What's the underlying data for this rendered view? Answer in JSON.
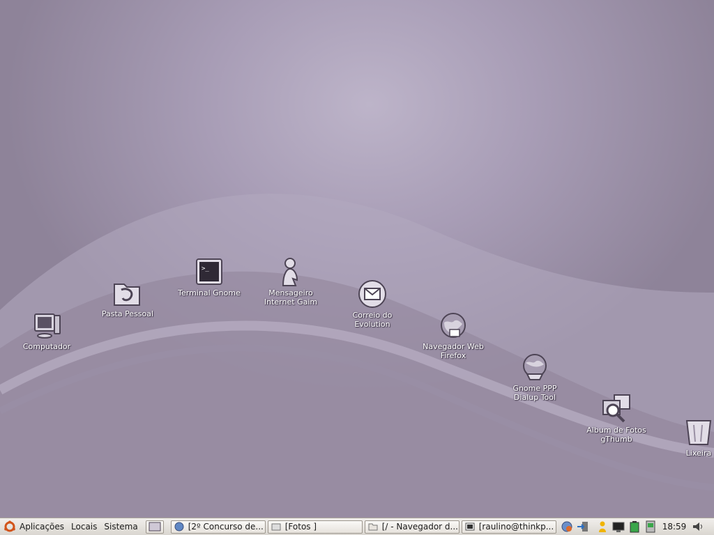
{
  "desktop": {
    "icons": [
      {
        "id": "computador",
        "label": "Computador",
        "icon": "computer-icon"
      },
      {
        "id": "pasta-pessoal",
        "label": "Pasta Pessoal",
        "icon": "home-folder-icon"
      },
      {
        "id": "terminal",
        "label": "Terminal Gnome",
        "icon": "terminal-icon"
      },
      {
        "id": "gaim",
        "label": "Mensageiro\nInternet Gaim",
        "icon": "messenger-icon"
      },
      {
        "id": "evolution",
        "label": "Correio do\nEvolution",
        "icon": "mail-icon"
      },
      {
        "id": "firefox",
        "label": "Navegador Web\nFirefox",
        "icon": "globe-icon"
      },
      {
        "id": "gnome-ppp",
        "label": "Gnome PPP\nDialup Tool",
        "icon": "dialup-icon"
      },
      {
        "id": "gthumb",
        "label": "Album de Fotos\ngThumb",
        "icon": "photo-album-icon"
      },
      {
        "id": "lixeira",
        "label": "Lixeira",
        "icon": "trash-icon"
      }
    ]
  },
  "panel": {
    "menus": {
      "applications": "Aplicações",
      "places": "Locais",
      "system": "Sistema"
    },
    "tasks": [
      {
        "label": "[2º Concurso de...",
        "icon": "browser-icon"
      },
      {
        "label": "[Fotos ]",
        "icon": "image-viewer-icon"
      },
      {
        "label": "[/ - Navegador d...",
        "icon": "folder-icon"
      },
      {
        "label": "[raulino@thinkp...",
        "icon": "terminal-icon"
      }
    ],
    "tray": [
      "network-icon",
      "logout-icon",
      "user-icon",
      "display-icon",
      "battery-icon",
      "memory-card-icon"
    ],
    "clock": "18:59",
    "volume_icon": "volume-icon"
  },
  "colors": {
    "panel_bg": "#e4e0da",
    "desktop_bg": "#a89db6",
    "icon_label": "#ffffff"
  }
}
